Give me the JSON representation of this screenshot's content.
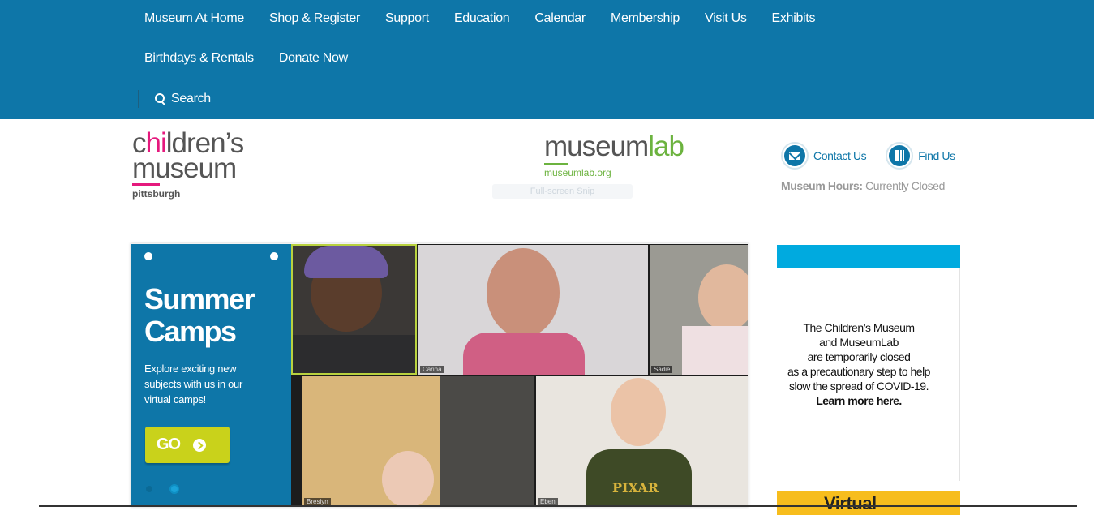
{
  "nav": {
    "row1": [
      "Museum At Home",
      "Shop & Register",
      "Support",
      "Education",
      "Calendar",
      "Membership",
      "Visit Us",
      "Exhibits"
    ],
    "row2": [
      "Birthdays & Rentals",
      "Donate Now"
    ],
    "search_label": "Search"
  },
  "header": {
    "logo": {
      "line1_pre": "c",
      "line1_pink": "hi",
      "line1_post": "ldren’s",
      "line2": "museum",
      "city": "pittsburgh"
    },
    "museumlab": {
      "name_gray": "museum",
      "name_green": "lab",
      "url": "museumlab.org"
    },
    "faded_caption": "Full-screen Snip",
    "contact_label": "Contact Us",
    "find_label": "Find Us",
    "hours_label": "Museum Hours:",
    "hours_value": "Currently Closed"
  },
  "slider": {
    "title_line1": "Summer",
    "title_line2": "Camps",
    "text": "Explore exciting new subjects with us in our virtual camps!",
    "go_label": "GO",
    "video_names": [
      "Carina",
      "Sadie",
      "Bresiyn",
      "Eben"
    ],
    "shirt_text": "PIXAR"
  },
  "notice": {
    "line1": "The Children’s Museum",
    "line2": "and MuseumLab",
    "line3": "are temporarily closed",
    "line4": "as a precautionary step to help",
    "line5": "slow the spread of COVID-19.",
    "line6": "Learn more here.",
    "virtual": "Virtual"
  },
  "colors": {
    "primary": "#0e76a8",
    "pink": "#e5197d",
    "green": "#6cb33f",
    "go": "#c9d21b",
    "cyan": "#00aadf",
    "yellow": "#f7bd1d"
  }
}
